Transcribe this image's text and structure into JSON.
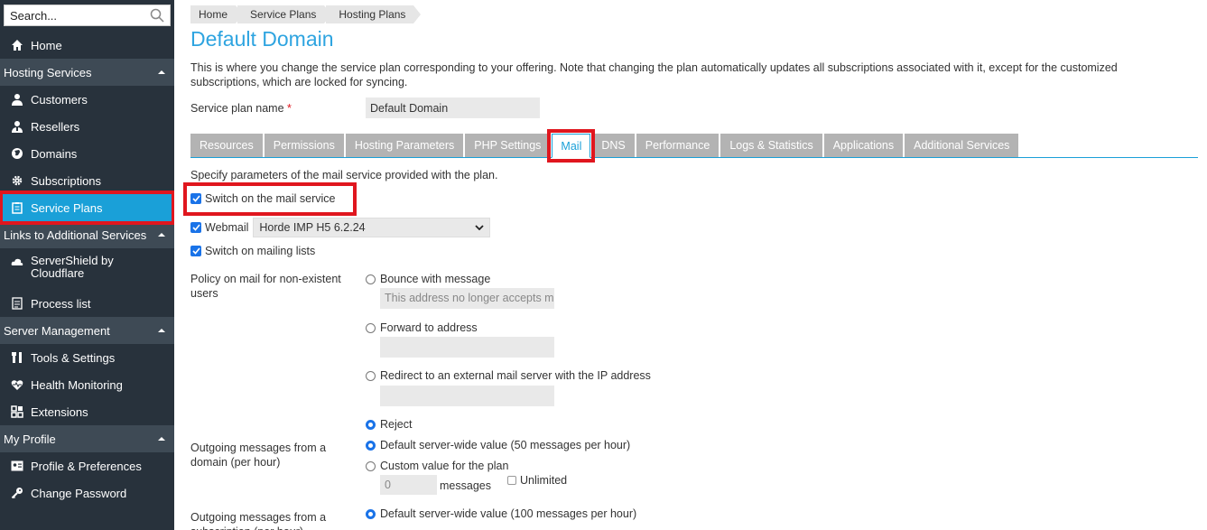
{
  "search": {
    "placeholder": "Search..."
  },
  "sidebar": {
    "home": "Home",
    "sections": [
      {
        "label": "Hosting Services"
      },
      {
        "label": "Links to Additional Services"
      },
      {
        "label": "Server Management"
      },
      {
        "label": "My Profile"
      }
    ],
    "hosting_items": [
      "Customers",
      "Resellers",
      "Domains",
      "Subscriptions",
      "Service Plans"
    ],
    "links_items": [
      "ServerShield by Cloudflare",
      "Process list"
    ],
    "server_items": [
      "Tools & Settings",
      "Health Monitoring",
      "Extensions"
    ],
    "profile_items": [
      "Profile & Preferences",
      "Change Password"
    ]
  },
  "breadcrumb": [
    "Home",
    "Service Plans",
    "Hosting Plans"
  ],
  "page": {
    "title": "Default Domain",
    "description": "This is where you change the service plan corresponding to your offering. Note that changing the plan automatically updates all subscriptions associated with it, except for the customized subscriptions, which are locked for syncing.",
    "plan_name_label": "Service plan name",
    "plan_name_required": "*",
    "plan_name_value": "Default Domain"
  },
  "tabs": [
    "Resources",
    "Permissions",
    "Hosting Parameters",
    "PHP Settings",
    "Mail",
    "DNS",
    "Performance",
    "Logs & Statistics",
    "Applications",
    "Additional Services"
  ],
  "active_tab": "Mail",
  "mail": {
    "intro": "Specify parameters of the mail service provided with the plan.",
    "switch_mail": "Switch on the mail service",
    "webmail_label": "Webmail",
    "webmail_value": "Horde IMP H5 6.2.24",
    "mailing_lists": "Switch on mailing lists",
    "policy_label": "Policy on mail for non-existent users",
    "bounce": "Bounce with message",
    "bounce_value": "This address no longer accepts mail.",
    "forward": "Forward to address",
    "redirect": "Redirect to an external mail server with the IP address",
    "reject": "Reject",
    "domain_out_label": "Outgoing messages from a domain (per hour)",
    "domain_default": "Default server-wide value (50 messages per hour)",
    "domain_custom": "Custom value for the plan",
    "custom_value": "0",
    "messages": "messages",
    "unlimited": "Unlimited",
    "sub_out_label": "Outgoing messages from a subscription (per hour)",
    "sub_default": "Default server-wide value (100 messages per hour)"
  }
}
